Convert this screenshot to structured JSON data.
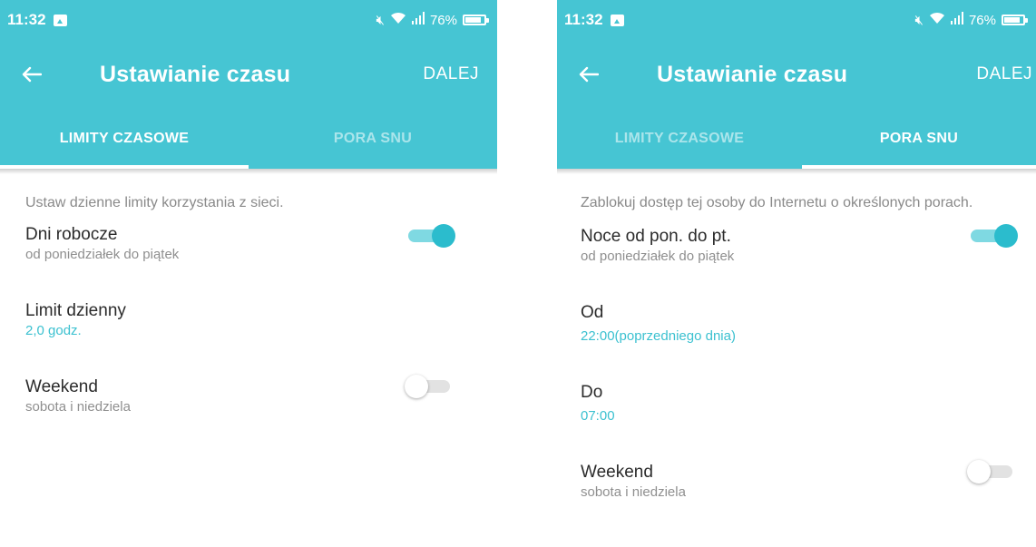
{
  "status_bar": {
    "time": "11:32",
    "battery": "76%"
  },
  "app_bar": {
    "title": "Ustawianie czasu",
    "next_label": "DALEJ"
  },
  "tabs": [
    {
      "label": "LIMITY CZASOWE"
    },
    {
      "label": "PORA SNU"
    }
  ],
  "left_screen": {
    "active_tab": 0,
    "description": "Ustaw dzienne limity korzystania z sieci.",
    "weekdays": {
      "title": "Dni robocze",
      "subtitle": "od poniedziałek do piątek",
      "enabled": true
    },
    "daily_limit": {
      "title": "Limit dzienny",
      "value": "2,0 godz."
    },
    "weekend": {
      "title": "Weekend",
      "subtitle": "sobota i niedziela",
      "enabled": false
    }
  },
  "right_screen": {
    "active_tab": 1,
    "description": "Zablokuj dostęp tej osoby do Internetu o określonych porach.",
    "weeknights": {
      "title": "Noce od pon. do pt.",
      "subtitle": "od poniedziałek do piątek",
      "enabled": true
    },
    "from": {
      "title": "Od",
      "value": "22:00(poprzedniego dnia)"
    },
    "to": {
      "title": "Do",
      "value": "07:00"
    },
    "weekend": {
      "title": "Weekend",
      "subtitle": "sobota i niedziela",
      "enabled": false
    }
  },
  "colors": {
    "primary": "#46c5d3",
    "accent": "#2bbccd",
    "value_text": "#3cc1d0"
  },
  "icons": {
    "back": "arrow-left",
    "gallery": "image",
    "mute": "volume-muted",
    "wifi": "wifi",
    "signal": "cell-signal",
    "battery": "battery"
  }
}
